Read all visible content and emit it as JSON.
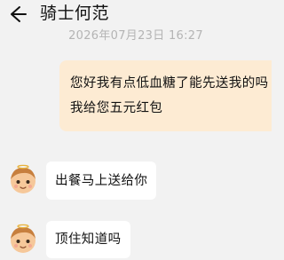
{
  "header": {
    "back_icon": "arrow-left-icon",
    "title": "骑士何范"
  },
  "chat": {
    "timestamp": "2026年07月23日 16:27",
    "messages": [
      {
        "direction": "outgoing",
        "lines": [
          "您好我有点低血糖了能先送我的吗",
          "我给您五元红包"
        ]
      },
      {
        "direction": "incoming",
        "avatar_icon": "cartoon-avatar-icon",
        "text": "出餐马上送给你"
      },
      {
        "direction": "incoming",
        "avatar_icon": "cartoon-avatar-icon",
        "text": "顶住知道吗"
      }
    ]
  },
  "colors": {
    "background": "#f2f2f2",
    "outgoing_bubble": "#fdebd3",
    "incoming_bubble": "#ffffff",
    "timestamp_text": "#b4b4b4"
  }
}
